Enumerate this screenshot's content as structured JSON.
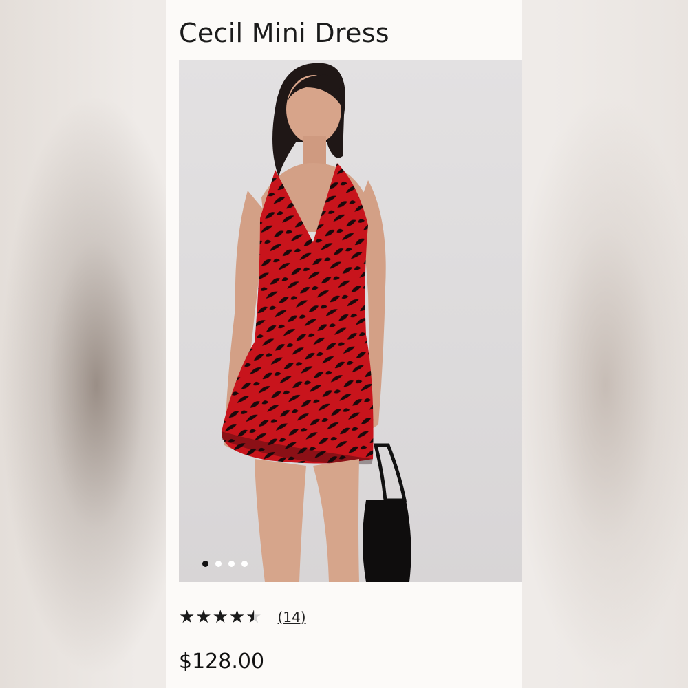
{
  "product": {
    "title": "Cecil Mini Dress",
    "price": "$128.00",
    "rating": {
      "value": 4.5,
      "max": 5,
      "stars_text": "★★★★★",
      "review_count": "(14)"
    },
    "image": {
      "alt": "Model wearing red and black print halter mini dress holding black bag",
      "carousel_total": 4,
      "carousel_active_index": 0
    }
  },
  "colors": {
    "dress_red": "#c8141c",
    "dress_pattern": "#1a0a0c",
    "card_bg": "#fcfaf8",
    "page_bg": "#ece8e4"
  }
}
